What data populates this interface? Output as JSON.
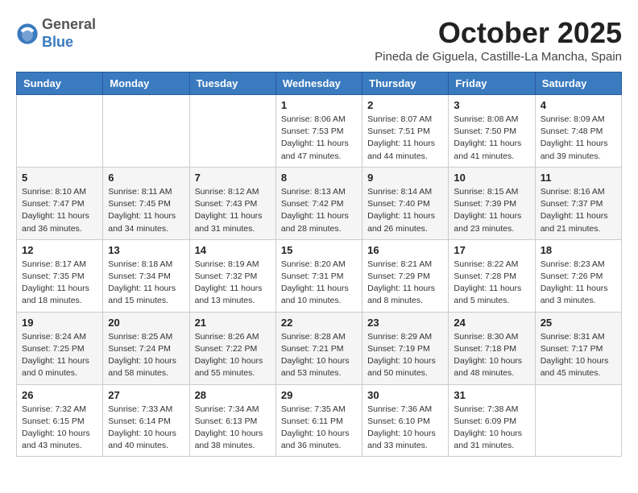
{
  "header": {
    "logo_general": "General",
    "logo_blue": "Blue",
    "month": "October 2025",
    "location": "Pineda de Giguela, Castille-La Mancha, Spain"
  },
  "weekdays": [
    "Sunday",
    "Monday",
    "Tuesday",
    "Wednesday",
    "Thursday",
    "Friday",
    "Saturday"
  ],
  "weeks": [
    [
      {
        "day": "",
        "info": ""
      },
      {
        "day": "",
        "info": ""
      },
      {
        "day": "",
        "info": ""
      },
      {
        "day": "1",
        "info": "Sunrise: 8:06 AM\nSunset: 7:53 PM\nDaylight: 11 hours and 47 minutes."
      },
      {
        "day": "2",
        "info": "Sunrise: 8:07 AM\nSunset: 7:51 PM\nDaylight: 11 hours and 44 minutes."
      },
      {
        "day": "3",
        "info": "Sunrise: 8:08 AM\nSunset: 7:50 PM\nDaylight: 11 hours and 41 minutes."
      },
      {
        "day": "4",
        "info": "Sunrise: 8:09 AM\nSunset: 7:48 PM\nDaylight: 11 hours and 39 minutes."
      }
    ],
    [
      {
        "day": "5",
        "info": "Sunrise: 8:10 AM\nSunset: 7:47 PM\nDaylight: 11 hours and 36 minutes."
      },
      {
        "day": "6",
        "info": "Sunrise: 8:11 AM\nSunset: 7:45 PM\nDaylight: 11 hours and 34 minutes."
      },
      {
        "day": "7",
        "info": "Sunrise: 8:12 AM\nSunset: 7:43 PM\nDaylight: 11 hours and 31 minutes."
      },
      {
        "day": "8",
        "info": "Sunrise: 8:13 AM\nSunset: 7:42 PM\nDaylight: 11 hours and 28 minutes."
      },
      {
        "day": "9",
        "info": "Sunrise: 8:14 AM\nSunset: 7:40 PM\nDaylight: 11 hours and 26 minutes."
      },
      {
        "day": "10",
        "info": "Sunrise: 8:15 AM\nSunset: 7:39 PM\nDaylight: 11 hours and 23 minutes."
      },
      {
        "day": "11",
        "info": "Sunrise: 8:16 AM\nSunset: 7:37 PM\nDaylight: 11 hours and 21 minutes."
      }
    ],
    [
      {
        "day": "12",
        "info": "Sunrise: 8:17 AM\nSunset: 7:35 PM\nDaylight: 11 hours and 18 minutes."
      },
      {
        "day": "13",
        "info": "Sunrise: 8:18 AM\nSunset: 7:34 PM\nDaylight: 11 hours and 15 minutes."
      },
      {
        "day": "14",
        "info": "Sunrise: 8:19 AM\nSunset: 7:32 PM\nDaylight: 11 hours and 13 minutes."
      },
      {
        "day": "15",
        "info": "Sunrise: 8:20 AM\nSunset: 7:31 PM\nDaylight: 11 hours and 10 minutes."
      },
      {
        "day": "16",
        "info": "Sunrise: 8:21 AM\nSunset: 7:29 PM\nDaylight: 11 hours and 8 minutes."
      },
      {
        "day": "17",
        "info": "Sunrise: 8:22 AM\nSunset: 7:28 PM\nDaylight: 11 hours and 5 minutes."
      },
      {
        "day": "18",
        "info": "Sunrise: 8:23 AM\nSunset: 7:26 PM\nDaylight: 11 hours and 3 minutes."
      }
    ],
    [
      {
        "day": "19",
        "info": "Sunrise: 8:24 AM\nSunset: 7:25 PM\nDaylight: 11 hours and 0 minutes."
      },
      {
        "day": "20",
        "info": "Sunrise: 8:25 AM\nSunset: 7:24 PM\nDaylight: 10 hours and 58 minutes."
      },
      {
        "day": "21",
        "info": "Sunrise: 8:26 AM\nSunset: 7:22 PM\nDaylight: 10 hours and 55 minutes."
      },
      {
        "day": "22",
        "info": "Sunrise: 8:28 AM\nSunset: 7:21 PM\nDaylight: 10 hours and 53 minutes."
      },
      {
        "day": "23",
        "info": "Sunrise: 8:29 AM\nSunset: 7:19 PM\nDaylight: 10 hours and 50 minutes."
      },
      {
        "day": "24",
        "info": "Sunrise: 8:30 AM\nSunset: 7:18 PM\nDaylight: 10 hours and 48 minutes."
      },
      {
        "day": "25",
        "info": "Sunrise: 8:31 AM\nSunset: 7:17 PM\nDaylight: 10 hours and 45 minutes."
      }
    ],
    [
      {
        "day": "26",
        "info": "Sunrise: 7:32 AM\nSunset: 6:15 PM\nDaylight: 10 hours and 43 minutes."
      },
      {
        "day": "27",
        "info": "Sunrise: 7:33 AM\nSunset: 6:14 PM\nDaylight: 10 hours and 40 minutes."
      },
      {
        "day": "28",
        "info": "Sunrise: 7:34 AM\nSunset: 6:13 PM\nDaylight: 10 hours and 38 minutes."
      },
      {
        "day": "29",
        "info": "Sunrise: 7:35 AM\nSunset: 6:11 PM\nDaylight: 10 hours and 36 minutes."
      },
      {
        "day": "30",
        "info": "Sunrise: 7:36 AM\nSunset: 6:10 PM\nDaylight: 10 hours and 33 minutes."
      },
      {
        "day": "31",
        "info": "Sunrise: 7:38 AM\nSunset: 6:09 PM\nDaylight: 10 hours and 31 minutes."
      },
      {
        "day": "",
        "info": ""
      }
    ]
  ]
}
